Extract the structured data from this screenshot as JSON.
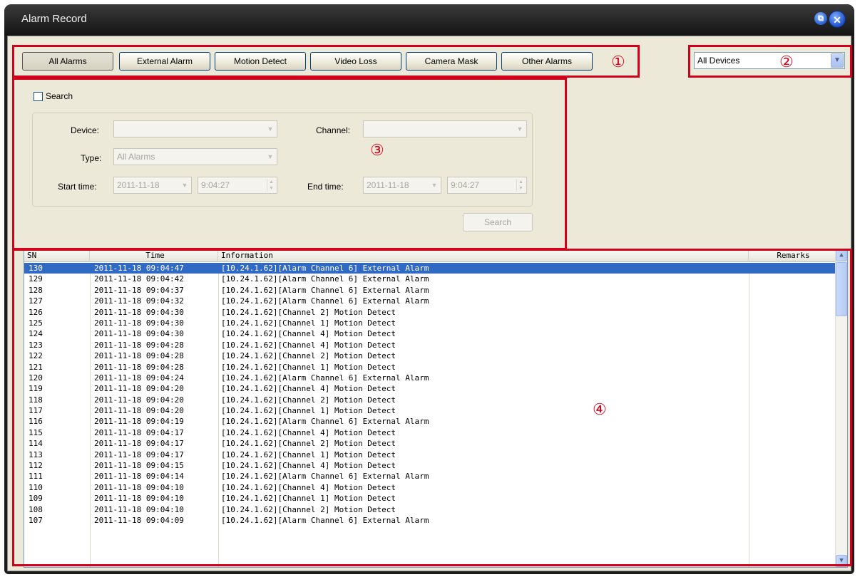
{
  "window": {
    "title": "Alarm Record",
    "restore_glyph": "⧉",
    "close_glyph": "✕"
  },
  "tabs": [
    {
      "label": "All Alarms",
      "active": true
    },
    {
      "label": "External Alarm",
      "active": false
    },
    {
      "label": "Motion Detect",
      "active": false
    },
    {
      "label": "Video Loss",
      "active": false
    },
    {
      "label": "Camera Mask",
      "active": false
    },
    {
      "label": "Other Alarms",
      "active": false
    }
  ],
  "device_filter": {
    "value": "All Devices",
    "arrow": "▼"
  },
  "annotations": {
    "n1": "①",
    "n2": "②",
    "n3": "③",
    "n4": "④",
    "color": "#d0021b"
  },
  "search_panel": {
    "checkbox_label": "Search",
    "device_label": "Device:",
    "device_value": "",
    "channel_label": "Channel:",
    "channel_value": "",
    "type_label": "Type:",
    "type_value": "All Alarms",
    "start_label": "Start time:",
    "start_date": "2011-11-18",
    "start_time": "9:04:27",
    "end_label": "End time:",
    "end_date": "2011-11-18",
    "end_time": "9:04:27",
    "search_button": "Search"
  },
  "table": {
    "columns": {
      "sn": "SN",
      "time": "Time",
      "info": "Information",
      "remarks": "Remarks"
    },
    "rows": [
      {
        "sn": "130",
        "time": "2011-11-18 09:04:47",
        "info": "[10.24.1.62][Alarm Channel 6] External Alarm",
        "selected": true
      },
      {
        "sn": "129",
        "time": "2011-11-18 09:04:42",
        "info": "[10.24.1.62][Alarm Channel 6] External Alarm"
      },
      {
        "sn": "128",
        "time": "2011-11-18 09:04:37",
        "info": "[10.24.1.62][Alarm Channel 6] External Alarm"
      },
      {
        "sn": "127",
        "time": "2011-11-18 09:04:32",
        "info": "[10.24.1.62][Alarm Channel 6] External Alarm"
      },
      {
        "sn": "126",
        "time": "2011-11-18 09:04:30",
        "info": "[10.24.1.62][Channel 2] Motion Detect"
      },
      {
        "sn": "125",
        "time": "2011-11-18 09:04:30",
        "info": "[10.24.1.62][Channel 1] Motion Detect"
      },
      {
        "sn": "124",
        "time": "2011-11-18 09:04:30",
        "info": "[10.24.1.62][Channel 4] Motion Detect"
      },
      {
        "sn": "123",
        "time": "2011-11-18 09:04:28",
        "info": "[10.24.1.62][Channel 4] Motion Detect"
      },
      {
        "sn": "122",
        "time": "2011-11-18 09:04:28",
        "info": "[10.24.1.62][Channel 2] Motion Detect"
      },
      {
        "sn": "121",
        "time": "2011-11-18 09:04:28",
        "info": "[10.24.1.62][Channel 1] Motion Detect"
      },
      {
        "sn": "120",
        "time": "2011-11-18 09:04:24",
        "info": "[10.24.1.62][Alarm Channel 6] External Alarm"
      },
      {
        "sn": "119",
        "time": "2011-11-18 09:04:20",
        "info": "[10.24.1.62][Channel 4] Motion Detect"
      },
      {
        "sn": "118",
        "time": "2011-11-18 09:04:20",
        "info": "[10.24.1.62][Channel 2] Motion Detect"
      },
      {
        "sn": "117",
        "time": "2011-11-18 09:04:20",
        "info": "[10.24.1.62][Channel 1] Motion Detect"
      },
      {
        "sn": "116",
        "time": "2011-11-18 09:04:19",
        "info": "[10.24.1.62][Alarm Channel 6] External Alarm"
      },
      {
        "sn": "115",
        "time": "2011-11-18 09:04:17",
        "info": "[10.24.1.62][Channel 4] Motion Detect"
      },
      {
        "sn": "114",
        "time": "2011-11-18 09:04:17",
        "info": "[10.24.1.62][Channel 2] Motion Detect"
      },
      {
        "sn": "113",
        "time": "2011-11-18 09:04:17",
        "info": "[10.24.1.62][Channel 1] Motion Detect"
      },
      {
        "sn": "112",
        "time": "2011-11-18 09:04:15",
        "info": "[10.24.1.62][Channel 4] Motion Detect"
      },
      {
        "sn": "111",
        "time": "2011-11-18 09:04:14",
        "info": "[10.24.1.62][Alarm Channel 6] External Alarm"
      },
      {
        "sn": "110",
        "time": "2011-11-18 09:04:10",
        "info": "[10.24.1.62][Channel 4] Motion Detect"
      },
      {
        "sn": "109",
        "time": "2011-11-18 09:04:10",
        "info": "[10.24.1.62][Channel 1] Motion Detect"
      },
      {
        "sn": "108",
        "time": "2011-11-18 09:04:10",
        "info": "[10.24.1.62][Channel 2] Motion Detect"
      },
      {
        "sn": "107",
        "time": "2011-11-18 09:04:09",
        "info": "[10.24.1.62][Alarm Channel 6] External Alarm"
      }
    ]
  },
  "scrollbar": {
    "up": "▲",
    "down": "▼"
  }
}
